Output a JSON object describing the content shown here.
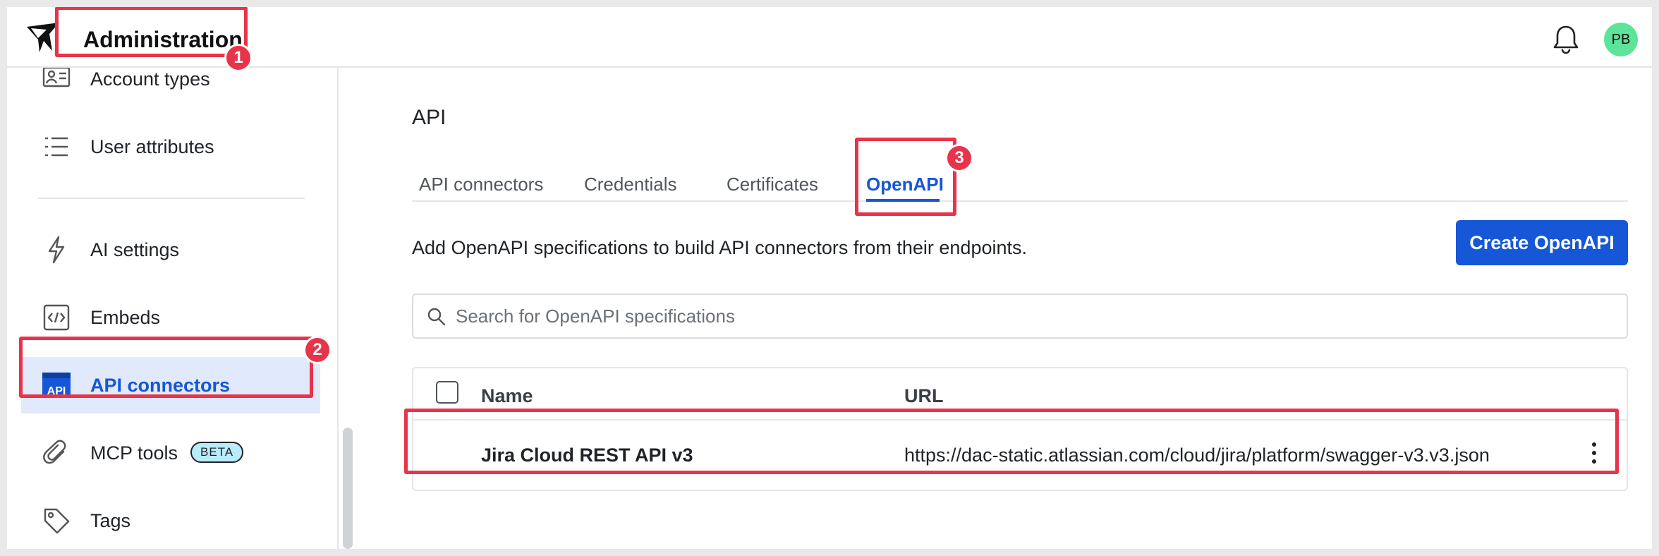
{
  "header": {
    "title": "Administration",
    "logo_icon": "brand-bird-logo",
    "notifications_icon": "bell-icon",
    "avatar_initials": "PB",
    "avatar_color": "#5ee39b"
  },
  "sidebar": {
    "items": [
      {
        "label": "Account types",
        "icon": "id-card-icon"
      },
      {
        "label": "User attributes",
        "icon": "list-icon"
      },
      {
        "label": "AI settings",
        "icon": "lightning-icon"
      },
      {
        "label": "Embeds",
        "icon": "code-icon"
      },
      {
        "label": "API connectors",
        "icon": "api-icon",
        "active": true
      },
      {
        "label": "MCP tools",
        "icon": "paperclip-icon",
        "badge": "BETA"
      },
      {
        "label": "Tags",
        "icon": "tag-icon"
      }
    ]
  },
  "main": {
    "section_title": "API",
    "tabs": [
      {
        "label": "API connectors"
      },
      {
        "label": "Credentials"
      },
      {
        "label": "Certificates"
      },
      {
        "label": "OpenAPI",
        "active": true
      }
    ],
    "description": "Add OpenAPI specifications to build API connectors from their endpoints.",
    "create_button": "Create OpenAPI",
    "search_placeholder": "Search for OpenAPI specifications",
    "table": {
      "columns": [
        "Name",
        "URL"
      ],
      "rows": [
        {
          "name": "Jira Cloud REST API v3",
          "url": "https://dac-static.atlassian.com/cloud/jira/platform/swagger-v3.v3.json"
        }
      ]
    }
  },
  "annotations": [
    {
      "label": "1"
    },
    {
      "label": "2"
    },
    {
      "label": "3"
    }
  ],
  "colors": {
    "accent": "#1557d6",
    "highlight": "#e8344a",
    "active_bg": "#e1e9fc",
    "beta_bg": "#b9ecfa"
  }
}
